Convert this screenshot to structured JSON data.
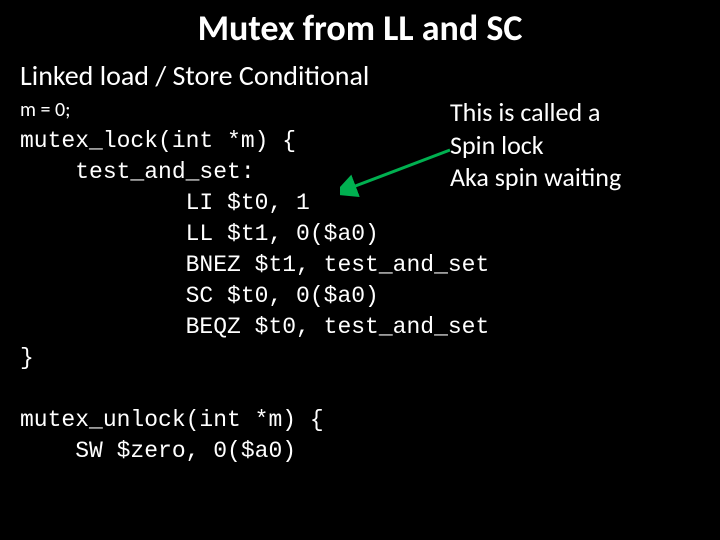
{
  "title": "Mutex from LL and SC",
  "subtitle": "Linked load / Store Conditional",
  "init_line": "m = 0;",
  "code": "mutex_lock(int *m) {\n    test_and_set:\n            LI $t0, 1\n            LL $t1, 0($a0)\n            BNEZ $t1, test_and_set\n            SC $t0, 0($a0)\n            BEQZ $t0, test_and_set\n}\n\nmutex_unlock(int *m) {\n    SW $zero, 0($a0)",
  "annotation": {
    "line1": "This is called a",
    "line2": "Spin lock",
    "line3": "Aka spin waiting"
  }
}
